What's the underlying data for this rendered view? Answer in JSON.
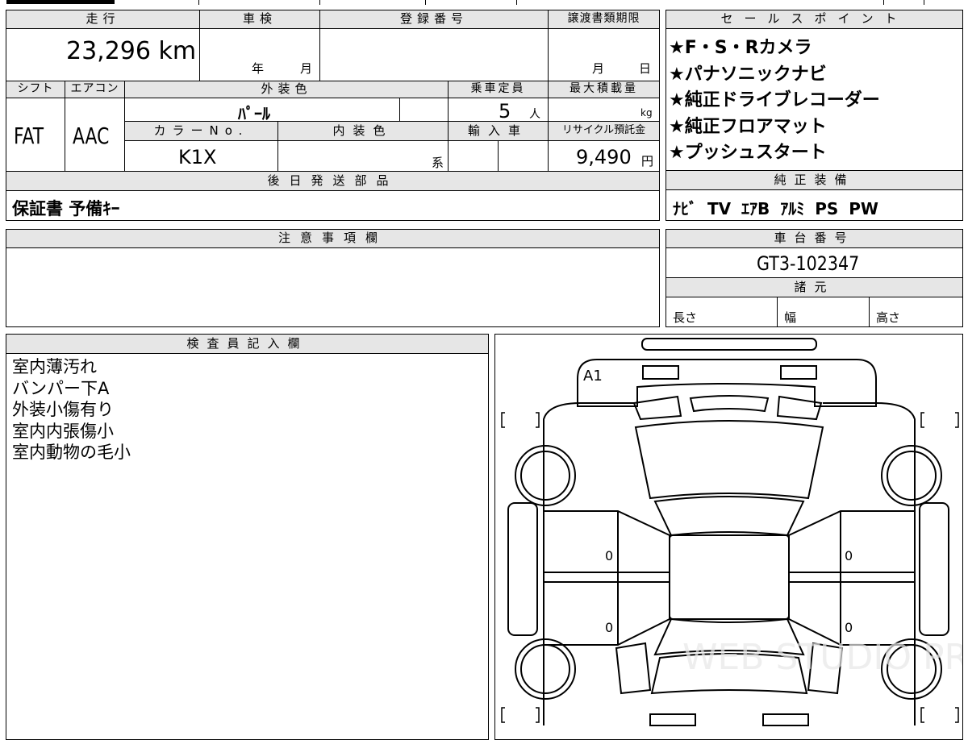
{
  "vehicle_info": {
    "mileage_label": "走行",
    "mileage_value": "23,296 km",
    "inspection_label": "車検",
    "inspection_year_unit": "年",
    "inspection_month_unit": "月",
    "registration_label": "登録番号",
    "registration_value": "",
    "transfer_deadline_label": "譲渡書類期限",
    "transfer_month_unit": "月",
    "transfer_day_unit": "日",
    "shift_label": "シフト",
    "shift_value": "FAT",
    "aircon_label": "エアコン",
    "aircon_value": "AAC",
    "exterior_color_label": "外装色",
    "exterior_color_value": "ﾊﾟｰﾙ",
    "capacity_label": "乗車定員",
    "capacity_value": "5",
    "capacity_unit": "人",
    "max_load_label": "最大積載量",
    "max_load_unit": "kg",
    "color_no_label": "カラーNo.",
    "color_no_value": "K1X",
    "interior_color_label": "内装色",
    "interior_color_suffix": "系",
    "import_label": "輸入車",
    "recycle_label": "リサイクル預託金",
    "recycle_value": "9,490",
    "recycle_unit": "円"
  },
  "sales_points": {
    "label": "セールスポイント",
    "items": [
      "★F・S・Rカメラ",
      "★パナソニックナビ",
      "★純正ドライブレコーダー",
      "★純正フロアマット",
      "★プッシュスタート"
    ]
  },
  "later_shipping": {
    "label": "後日発送部品",
    "value": "保証書 予備ｷｰ"
  },
  "genuine_equipment": {
    "label": "純正装備",
    "value": "ﾅﾋﾞ TV ｴｱB ｱﾙﾐ PS PW"
  },
  "notes": {
    "label": "注意事項欄",
    "value": ""
  },
  "chassis": {
    "label": "車台番号",
    "value": "GT3-102347"
  },
  "specs": {
    "label": "諸元",
    "length_label": "長さ",
    "width_label": "幅",
    "height_label": "高さ"
  },
  "inspector": {
    "label": "検査員記入欄",
    "lines": [
      "室内薄汚れ",
      "バンパー下A",
      "外装小傷有り",
      "室内内張傷小",
      "室内動物の毛小"
    ]
  },
  "diagram": {
    "front_mark": "A1",
    "door_marks": [
      "0",
      "0",
      "0",
      "0"
    ],
    "watermark": "WEB STUDIO PRO"
  }
}
